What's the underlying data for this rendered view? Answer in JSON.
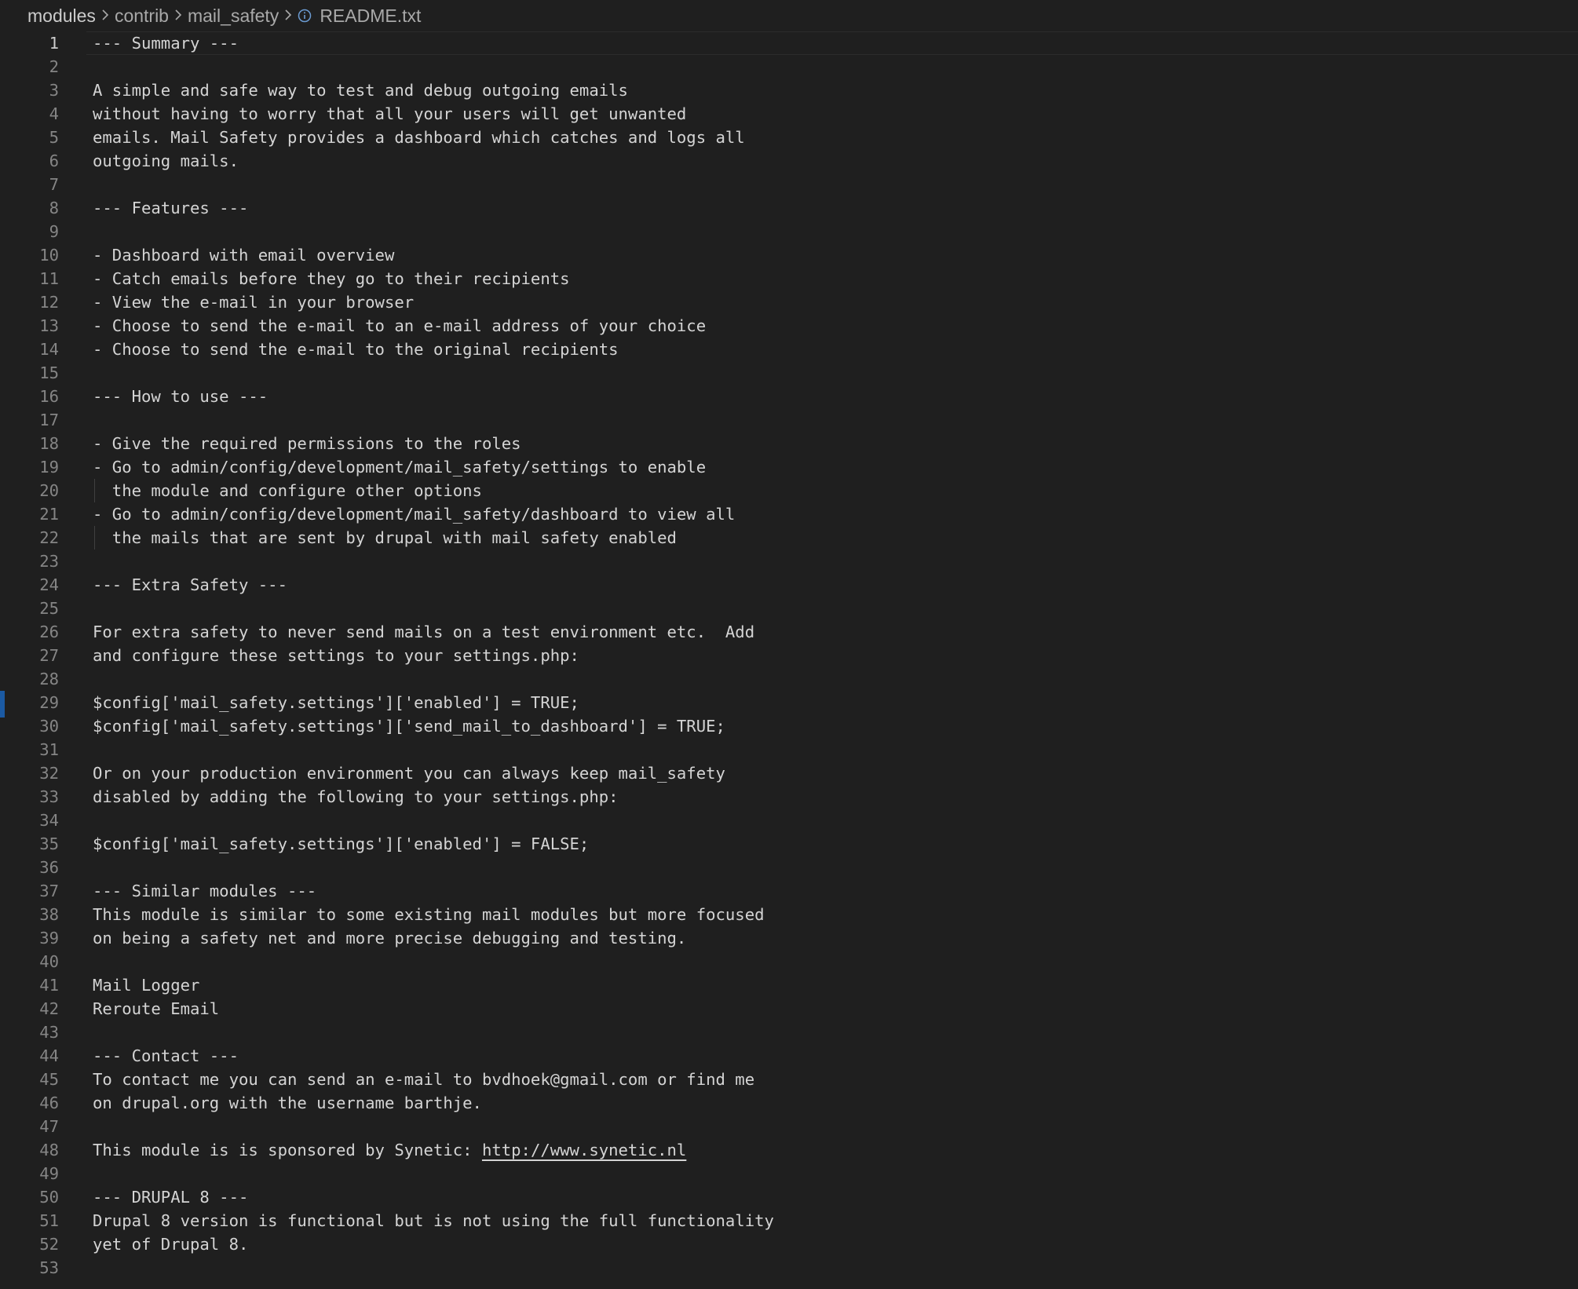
{
  "breadcrumb": {
    "items": [
      "modules",
      "contrib",
      "mail_safety"
    ],
    "file": "README.txt",
    "file_icon": "info-icon"
  },
  "editor": {
    "active_line": 1,
    "lines": [
      "--- Summary ---",
      "",
      "A simple and safe way to test and debug outgoing emails",
      "without having to worry that all your users will get unwanted",
      "emails. Mail Safety provides a dashboard which catches and logs all",
      "outgoing mails.",
      "",
      "--- Features ---",
      "",
      "- Dashboard with email overview",
      "- Catch emails before they go to their recipients",
      "- View the e-mail in your browser",
      "- Choose to send the e-mail to an e-mail address of your choice",
      "- Choose to send the e-mail to the original recipients",
      "",
      "--- How to use ---",
      "",
      "- Give the required permissions to the roles",
      "- Go to admin/config/development/mail_safety/settings to enable",
      "  the module and configure other options",
      "- Go to admin/config/development/mail_safety/dashboard to view all",
      "  the mails that are sent by drupal with mail safety enabled",
      "",
      "--- Extra Safety ---",
      "",
      "For extra safety to never send mails on a test environment etc.  Add",
      "and configure these settings to your settings.php:",
      "",
      "$config['mail_safety.settings']['enabled'] = TRUE;",
      "$config['mail_safety.settings']['send_mail_to_dashboard'] = TRUE;",
      "",
      "Or on your production environment you can always keep mail_safety",
      "disabled by adding the following to your settings.php:",
      "",
      "$config['mail_safety.settings']['enabled'] = FALSE;",
      "",
      "--- Similar modules ---",
      "This module is similar to some existing mail modules but more focused",
      "on being a safety net and more precise debugging and testing.",
      "",
      "Mail Logger",
      "Reroute Email",
      "",
      "--- Contact ---",
      "To contact me you can send an e-mail to bvdhoek@gmail.com or find me",
      "on drupal.org with the username barthje.",
      "",
      "This module is is sponsored by Synetic: ",
      "",
      "--- DRUPAL 8 ---",
      "Drupal 8 version is functional but is not using the full functionality",
      "yet of Drupal 8.",
      ""
    ],
    "link_line": 48,
    "link_text": "http://www.synetic.nl"
  }
}
